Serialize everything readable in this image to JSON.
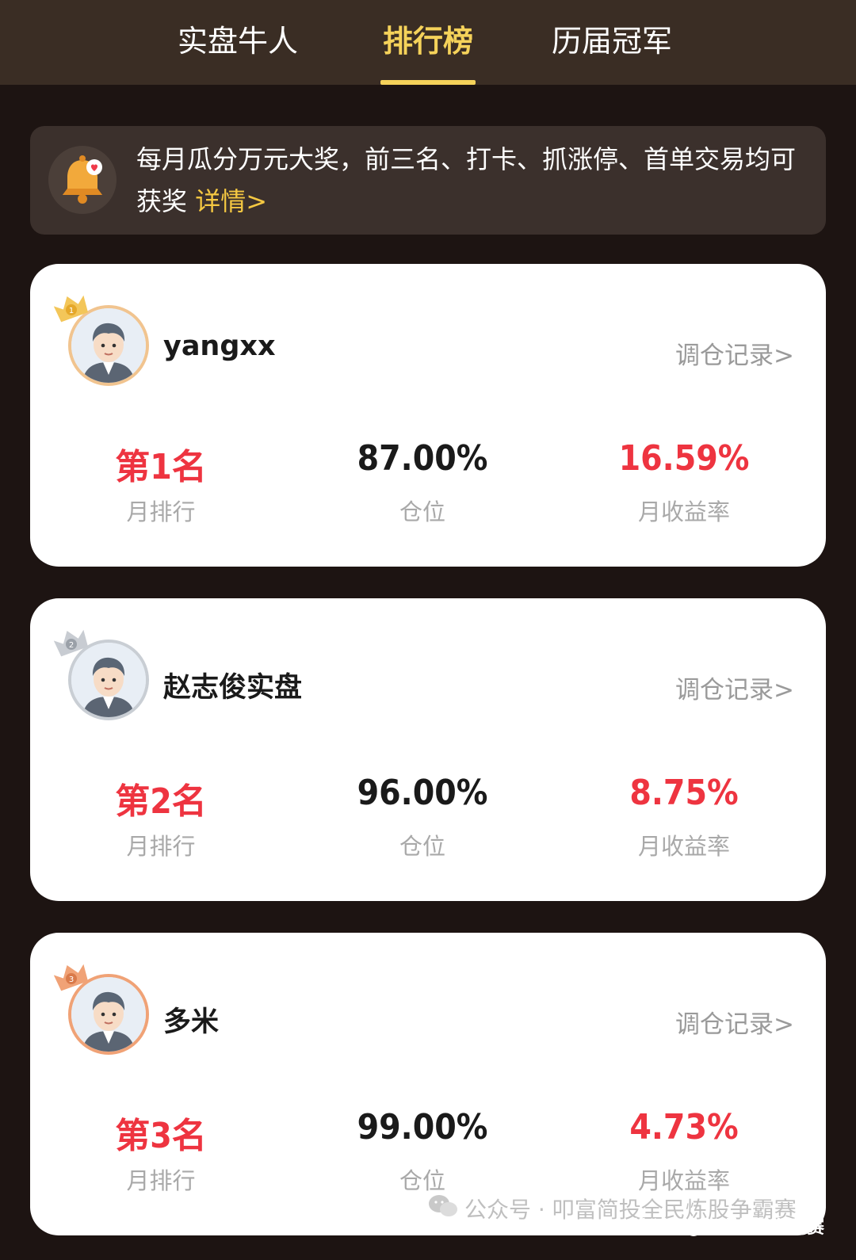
{
  "tabs": [
    {
      "label": "实盘牛人",
      "active": false
    },
    {
      "label": "排行榜",
      "active": true
    },
    {
      "label": "历届冠军",
      "active": false
    }
  ],
  "notice": {
    "text": "每月瓜分万元大奖，前三名、打卡、抓涨停、首单交易均可获奖",
    "link": "详情>",
    "icon": "bell-icon"
  },
  "cards": [
    {
      "username": "yangxx",
      "record_link": "调仓记录>",
      "medal": "1",
      "rank_value": "第1名",
      "rank_label": "月排行",
      "position_value": "87.00%",
      "position_label": "仓位",
      "return_value": "16.59%",
      "return_label": "月收益率"
    },
    {
      "username": "赵志俊实盘",
      "record_link": "调仓记录>",
      "medal": "2",
      "rank_value": "第2名",
      "rank_label": "月排行",
      "position_value": "96.00%",
      "position_label": "仓位",
      "return_value": "8.75%",
      "return_label": "月收益率"
    },
    {
      "username": "多米",
      "record_link": "调仓记录>",
      "medal": "3",
      "rank_value": "第3名",
      "rank_label": "月排行",
      "position_value": "99.00%",
      "position_label": "仓位",
      "return_value": "4.73%",
      "return_label": "月收益率"
    }
  ],
  "watermark": "公众号 · 叩富简投全民炼股争霸赛",
  "sohu_mark": "搜狐号@叩富简投争霸赛",
  "colors": {
    "accent": "#f5d25a",
    "red": "#ee3440",
    "bg": "#1d1412"
  }
}
